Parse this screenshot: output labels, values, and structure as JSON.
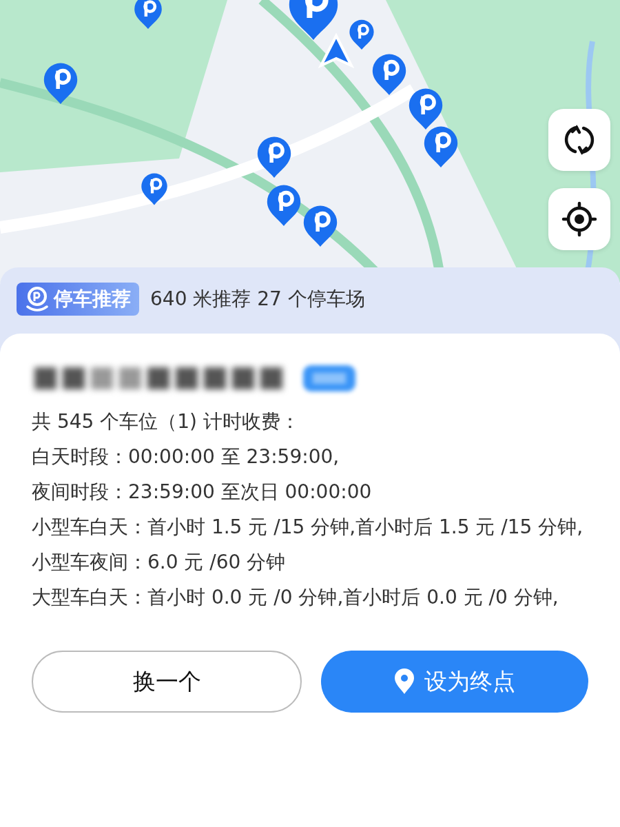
{
  "map": {
    "kind": "picture",
    "controls": [
      {
        "kind": "refresh"
      },
      {
        "kind": "locate"
      }
    ]
  },
  "recommend": {
    "badge": "停车推荐",
    "summary": "640 米推荐 27 个停车场"
  },
  "lot": {
    "lines": [
      "共 545 个车位（1) 计时收费：",
      "白天时段：00:00:00 至 23:59:00,",
      "夜间时段：23:59:00 至次日 00:00:00",
      "小型车白天：首小时 1.5 元 /15 分钟,首小时后 1.5 元 /15 分钟,",
      "小型车夜间：6.0 元 /60 分钟",
      "大型车白天：首小时 0.0 元 /0 分钟,首小时后 0.0 元 /0 分钟,"
    ]
  },
  "buttons": [
    {
      "kind": "secondary",
      "label": "换一个"
    },
    {
      "kind": "primary",
      "label": "设为终点"
    }
  ]
}
